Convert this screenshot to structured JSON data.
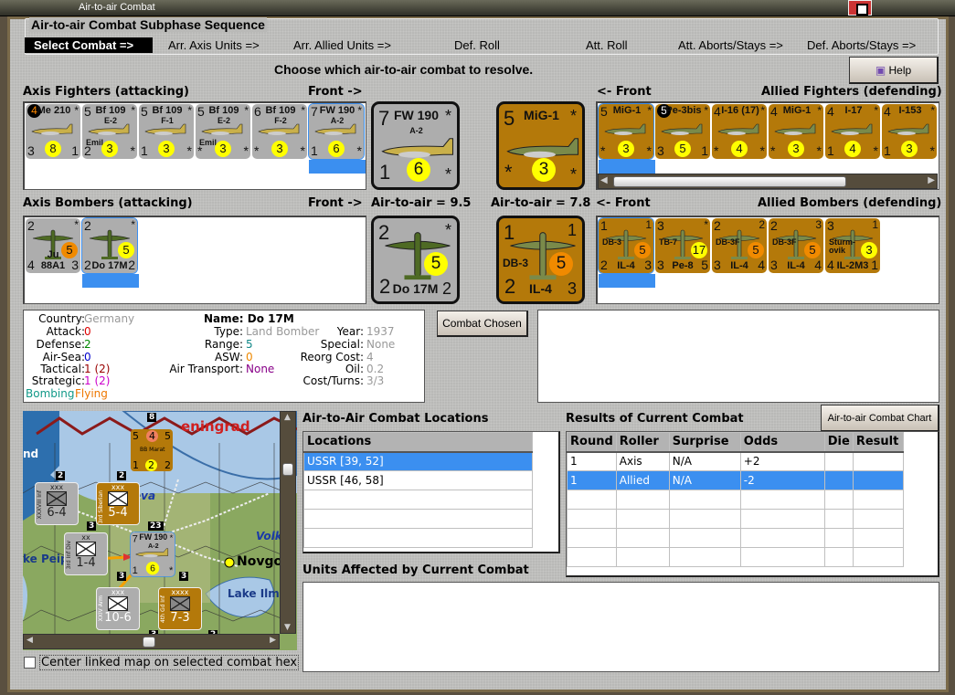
{
  "window": {
    "title": "Air-to-air Combat"
  },
  "sequence": {
    "title": "Air-to-air Combat Subphase Sequence",
    "steps": [
      "Select Combat =>",
      "Arr. Axis Units =>",
      "Arr. Allied Units =>",
      "Def. Roll",
      "Att. Roll",
      "Att. Aborts/Stays =>",
      "Def. Aborts/Stays =>"
    ],
    "selected_index": 0
  },
  "prompt": "Choose which air-to-air combat to resolve.",
  "help_button": "Help",
  "labels": {
    "axis_fighters": "Axis Fighters (attacking)",
    "front_right": "Front ->",
    "front_left": "<- Front",
    "allied_fighters": "Allied Fighters (defending)",
    "axis_bombers": "Axis Bombers (attacking)",
    "allied_bombers": "Allied Bombers (defending)",
    "axis_a2a": "Air-to-air = 9.5",
    "allied_a2a": "Air-to-air = 7.8"
  },
  "axis_fighters": [
    {
      "tl": "4",
      "name": "Me 210",
      "tr": "*",
      "bl": "3",
      "val": "8",
      "br": "1",
      "tlBadge": true
    },
    {
      "tl": "5",
      "name": "Bf 109",
      "sub": "E-2",
      "note": "Emil",
      "tr": "*",
      "bl": "2",
      "val": "3",
      "br": "*"
    },
    {
      "tl": "5",
      "name": "Bf 109",
      "sub": "F-1",
      "tr": "*",
      "bl": "1",
      "val": "3",
      "br": "*"
    },
    {
      "tl": "5",
      "name": "Bf 109",
      "sub": "E-2",
      "note": "Emil",
      "tr": "*",
      "bl": "*",
      "val": "3",
      "br": "*"
    },
    {
      "tl": "6",
      "name": "Bf 109",
      "sub": "F-2",
      "tr": "*",
      "bl": "*",
      "val": "3",
      "br": "*"
    },
    {
      "tl": "7",
      "name": "FW 190",
      "sub": "A-2",
      "tr": "*",
      "bl": "1",
      "val": "6",
      "br": "*",
      "selected": true
    }
  ],
  "axis_fighter_active": {
    "tl": "7",
    "name": "FW 190",
    "sub": "A-2",
    "tr": "*",
    "bl": "1",
    "val": "6",
    "br": "*"
  },
  "allied_fighter_active": {
    "tl": "5",
    "name": "MiG-1",
    "tr": "*",
    "bl": "*",
    "val": "3",
    "br": "*"
  },
  "allied_fighters": [
    {
      "tl": "5",
      "name": "MiG-1",
      "tr": "*",
      "bl": "*",
      "val": "3",
      "br": "*",
      "selected": true
    },
    {
      "tl": "5",
      "name": "Pe-3bis",
      "tr": "*",
      "bl": "3",
      "val": "5",
      "br": "1",
      "tlBadge": true
    },
    {
      "tl": "4",
      "name": "I-16 (17)",
      "tr": "*",
      "bl": "*",
      "val": "4",
      "br": "*"
    },
    {
      "tl": "4",
      "name": "MiG-1",
      "tr": "*",
      "bl": "*",
      "val": "3",
      "br": "*"
    },
    {
      "tl": "4",
      "name": "I-17",
      "tr": "*",
      "bl": "1",
      "val": "4",
      "br": "*"
    },
    {
      "tl": "4",
      "name": "I-153",
      "tr": "*",
      "bl": "1",
      "val": "3",
      "br": "*"
    }
  ],
  "allied_fighters_scroll": 0.75,
  "axis_bombers": [
    {
      "tl": "2",
      "tr": "*",
      "bl": "4",
      "bname": "Ju 88A1",
      "br": "3",
      "val": "5",
      "orange": true
    },
    {
      "tl": "2",
      "tr": "*",
      "bl": "2",
      "bname": "Do 17M",
      "br": "2",
      "val": "5",
      "selected": true
    }
  ],
  "axis_bomber_active": {
    "tl": "2",
    "tr": "*",
    "bl": "2",
    "bname": "Do 17M",
    "br": "2",
    "val": "5"
  },
  "allied_bomber_active": {
    "tl": "1",
    "tr": "1",
    "bl": "2",
    "bname": "IL-4",
    "br": "3",
    "val": "5",
    "note": "DB-3",
    "orange": true
  },
  "allied_bombers": [
    {
      "tl": "1",
      "tr": "1",
      "bl": "2",
      "bname": "IL-4",
      "br": "3",
      "val": "5",
      "note": "DB-3",
      "orange": true,
      "selected": true
    },
    {
      "tl": "3",
      "tr": "*",
      "bl": "3",
      "bname": "Pe-8",
      "br": "5",
      "val": "17",
      "note": "TB-7"
    },
    {
      "tl": "2",
      "tr": "2",
      "bl": "3",
      "bname": "IL-4",
      "br": "4",
      "val": "5",
      "note": "DB-3F",
      "orange": true
    },
    {
      "tl": "2",
      "tr": "3",
      "bl": "3",
      "bname": "IL-4",
      "br": "4",
      "val": "5",
      "note": "DB-3F",
      "orange": true
    },
    {
      "tl": "3",
      "tr": "1",
      "bl": "4",
      "bname": "IL-2M3",
      "br": "1",
      "val": "3",
      "note": "Sturm-ovik"
    }
  ],
  "info": {
    "country_k": "Country:",
    "country": "Germany",
    "attack_k": "Attack:",
    "attack": "0",
    "defense_k": "Defense:",
    "defense": "2",
    "airsea_k": "Air-Sea:",
    "airsea": "0",
    "tactical_k": "Tactical:",
    "tactical": "1 (2)",
    "strategic_k": "Strategic:",
    "strategic": "1 (2)",
    "bombing": "Bombing",
    "flying": "Flying",
    "name": "Name: Do 17M",
    "type_k": "Type:",
    "type": "Land Bomber",
    "range_k": "Range:",
    "range": "5",
    "asw_k": "ASW:",
    "asw": "0",
    "airtrans_k": "Air Transport:",
    "airtrans": "None",
    "year_k": "Year:",
    "year": "1937",
    "special_k": "Special:",
    "special": "None",
    "reorg_k": "Reorg Cost:",
    "reorg": "4",
    "oil_k": "Oil:",
    "oil": "0.2",
    "cost_k": "Cost/Turns:",
    "cost": "3/3"
  },
  "combat_chosen_button": "Combat Chosen",
  "locations": {
    "title": "Air-to-Air Combat Locations",
    "header": "Locations",
    "rows": [
      "USSR [39, 52]",
      "USSR [46, 58]",
      "",
      "",
      ""
    ],
    "selected_index": 0
  },
  "results": {
    "title": "Results of Current Combat",
    "chart_button": "Air-to-air Combat Chart",
    "columns": [
      "Round",
      "Roller",
      "Surprise",
      "Odds",
      "Die",
      "Result"
    ],
    "rows": [
      [
        "1",
        "Axis",
        "N/A",
        "+2",
        "",
        ""
      ],
      [
        "1",
        "Allied",
        "N/A",
        "-2",
        "",
        ""
      ],
      [
        "",
        "",
        "",
        "",
        "",
        ""
      ],
      [
        "",
        "",
        "",
        "",
        "",
        ""
      ],
      [
        "",
        "",
        "",
        "",
        "",
        ""
      ],
      [
        "",
        "",
        "",
        "",
        "",
        ""
      ]
    ],
    "selected_index": 1
  },
  "affected": {
    "title": "Units Affected by Current Combat"
  },
  "map": {
    "places": [
      "Leningrad",
      "Neva",
      "Volkhov",
      "Lake Peipus",
      "Novgorod",
      "Lake Ilmen"
    ],
    "place_text": [
      "eningrad",
      "eva",
      "Volk",
      "ke Peip",
      "Novgo",
      "Lake Ilm",
      "nd"
    ],
    "units": [
      {
        "top": "xxx",
        "val": "6-4",
        "side": "XXXVIII Inf"
      },
      {
        "top": "xxx",
        "val": "5-4",
        "side": "3rd Siberian"
      },
      {
        "top": "xx",
        "val": "1-4",
        "side": "3rd Inf Div"
      },
      {
        "top": "xxx",
        "val": "10-6",
        "side": "XXIV Arm"
      },
      {
        "top": "xxxx",
        "val": "7-3",
        "side": "4th Gd Inf"
      }
    ],
    "ship": {
      "tl": "5",
      "val": "4",
      "tr": "5",
      "name": "BB Marat",
      "bl": "1",
      "circ": "2",
      "br": "2"
    },
    "stack_numbers": [
      "8",
      "2",
      "2",
      "3",
      "23",
      "3",
      "3",
      "3",
      "2"
    ],
    "h_scroll": 0.45,
    "v_scroll": 0.2
  },
  "center_map_checkbox": {
    "label": "Center linked map on selected combat hex",
    "checked": false
  }
}
